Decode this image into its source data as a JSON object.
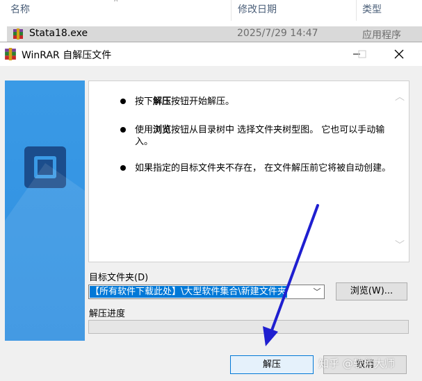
{
  "explorer": {
    "columns": {
      "name": "名称",
      "modified": "修改日期",
      "type": "类型"
    },
    "file": {
      "name": "Stata18.exe",
      "modified": "2025/7/29 14:47",
      "type": "应用程序"
    }
  },
  "dialog": {
    "title": "WinRAR 自解压文件",
    "info": {
      "line1_pre": "按下",
      "line1_bold": "解压",
      "line1_post": "按钮开始解压。",
      "line2_pre": "使用",
      "line2_bold": "浏览",
      "line2_post": "按钮从目录树中 选择文件夹树型图。 它也可以手动输入。",
      "line3": "如果指定的目标文件夹不存在， 在文件解压前它将被自动创建。"
    },
    "dest_label": "目标文件夹(D)",
    "dest_value": "【所有软件下载此处】\\大型软件集合\\新建文件夹",
    "browse_label": "浏览(W)...",
    "progress_label": "解压进度",
    "progress": 0,
    "extract_label": "解压",
    "cancel_label": "取消"
  },
  "watermark": "知乎 @软件大师",
  "colors": {
    "banner": "#3a9ae6",
    "selection": "#0078d7",
    "annotation_arrow": "#1f1fd0"
  }
}
